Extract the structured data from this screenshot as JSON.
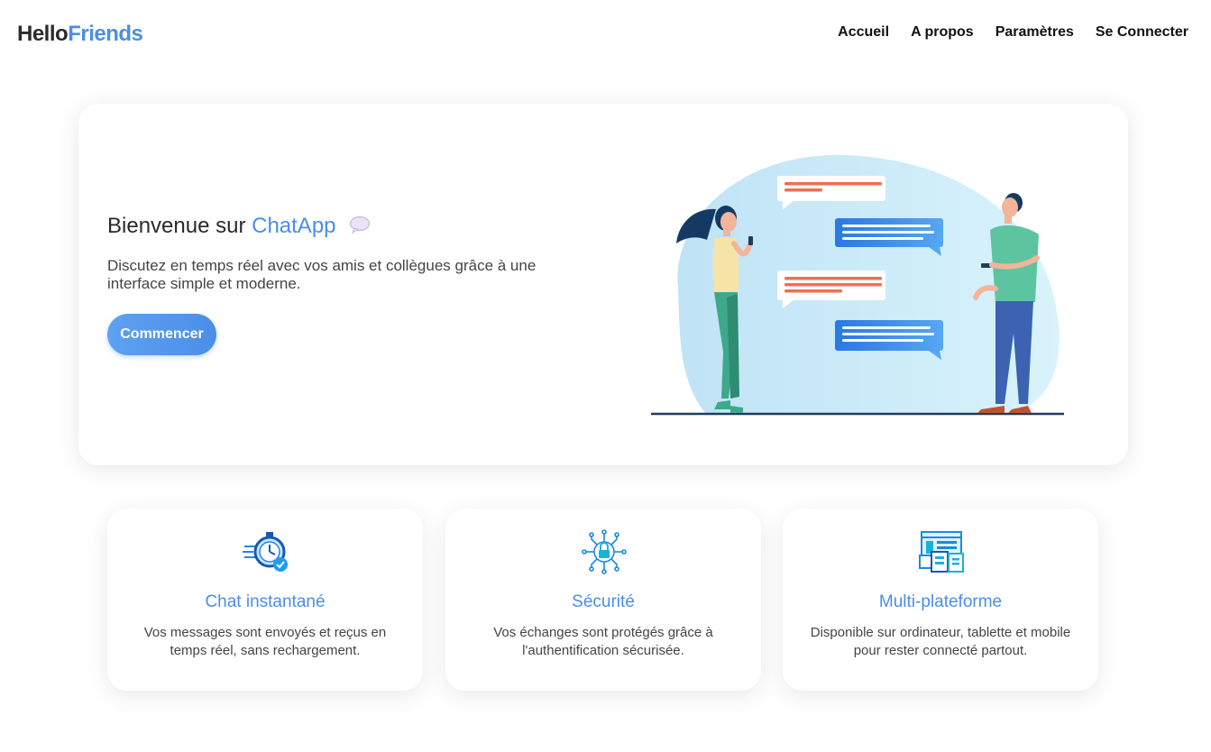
{
  "brand": {
    "part1": "Hello",
    "part2": "Friends"
  },
  "nav": {
    "items": [
      "Accueil",
      "A propos",
      "Paramètres",
      "Se Connecter"
    ]
  },
  "hero": {
    "title_prefix": "Bienvenue sur ",
    "title_accent": "ChatApp",
    "title_icon": "speech-bubble-icon",
    "description": "Discutez en temps réel avec vos amis et collègues grâce à une interface simple et moderne.",
    "cta_label": "Commencer",
    "illustration": "two-people-chatting-illustration"
  },
  "features": [
    {
      "icon": "stopwatch-icon",
      "title": "Chat instantané",
      "text": "Vos messages sont envoyés et reçus en temps réel, sans rechargement."
    },
    {
      "icon": "padlock-circuit-icon",
      "title": "Sécurité",
      "text": "Vos échanges sont protégés grâce à l'authentification sécurisée."
    },
    {
      "icon": "devices-icon",
      "title": "Multi-plateforme",
      "text": "Disponible sur ordinateur, tablette et mobile pour rester connecté partout."
    }
  ],
  "colors": {
    "accent": "#4a8ee8",
    "button": "#5ea2f2",
    "bubble_orange": "#ef6f4f",
    "bubble_blue": "#2f7fe6"
  }
}
